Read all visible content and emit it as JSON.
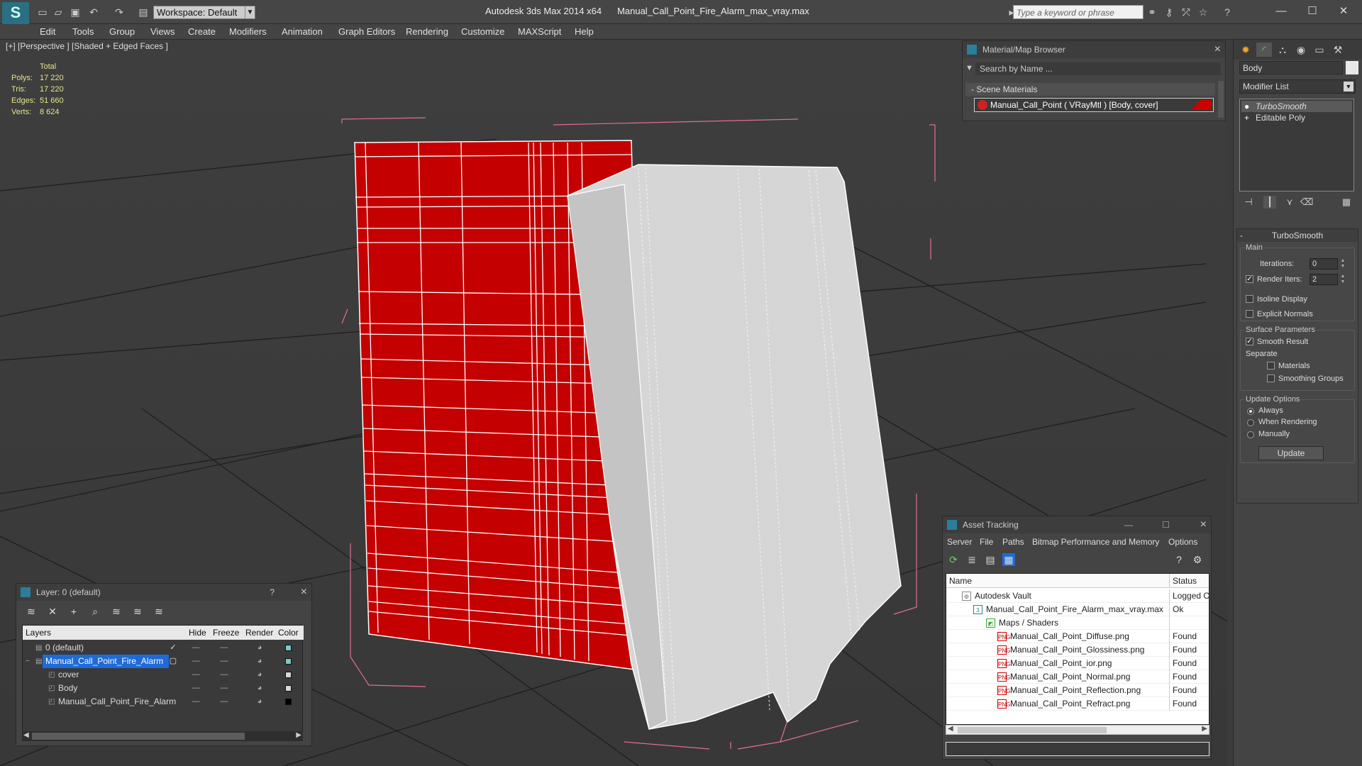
{
  "app": {
    "title": "Autodesk 3ds Max  2014 x64",
    "file": "Manual_Call_Point_Fire_Alarm_max_vray.max",
    "workspace": "Workspace: Default",
    "search_placeholder": "Type a keyword or phrase"
  },
  "menu": [
    "Edit",
    "Tools",
    "Group",
    "Views",
    "Create",
    "Modifiers",
    "Animation",
    "Graph Editors",
    "Rendering",
    "Customize",
    "MAXScript",
    "Help"
  ],
  "viewport": {
    "label": "[+] [Perspective ] [Shaded + Edged Faces ]",
    "stats": {
      "header": "Total",
      "rows": [
        {
          "k": "Polys:",
          "v": "17 220"
        },
        {
          "k": "Tris:",
          "v": "17 220"
        },
        {
          "k": "Edges:",
          "v": "51 660"
        },
        {
          "k": "Verts:",
          "v": "8 624"
        }
      ]
    },
    "colors": {
      "body": "#c40000",
      "cover": "#d9d9d9",
      "wire": "#ffffff",
      "bbox": "#e06a9a",
      "grid": "#1a1a1a"
    }
  },
  "material_browser": {
    "title": "Material/Map Browser",
    "search": "Search by Name ...",
    "section": "- Scene Materials",
    "material": "Manual_Call_Point  ( VRayMtl )  [Body, cover]"
  },
  "command_panel": {
    "object_name": "Body",
    "modifier_list": "Modifier List",
    "stack": [
      "TurboSmooth",
      "Editable Poly"
    ],
    "turbosmooth": {
      "title": "TurboSmooth",
      "main": "Main",
      "iterations_label": "Iterations:",
      "iterations": "0",
      "render_iters_label": "Render Iters:",
      "render_iters": "2",
      "isoline": "Isoline Display",
      "explicit": "Explicit Normals",
      "surface": "Surface Parameters",
      "smooth_result": "Smooth Result",
      "separate": "Separate",
      "materials": "Materials",
      "smoothing_groups": "Smoothing Groups",
      "update_options": "Update Options",
      "always": "Always",
      "when_rendering": "When Rendering",
      "manually": "Manually",
      "update_button": "Update"
    }
  },
  "layer_panel": {
    "title": "Layer: 0 (default)",
    "help": "?",
    "columns": {
      "layers": "Layers",
      "hide": "Hide",
      "freeze": "Freeze",
      "render": "Render",
      "color": "Color"
    },
    "rows": [
      {
        "name": "0 (default)",
        "indent": 1,
        "color": "#7ec8c8"
      },
      {
        "name": "Manual_Call_Point_Fire_Alarm",
        "indent": 1,
        "color": "#7ec8c8",
        "selected": true
      },
      {
        "name": "cover",
        "indent": 2,
        "color": "#d8d8d8"
      },
      {
        "name": "Body",
        "indent": 2,
        "color": "#d8d8d8"
      },
      {
        "name": "Manual_Call_Point_Fire_Alarm",
        "indent": 2,
        "color": "#000000"
      }
    ]
  },
  "asset_tracking": {
    "title": "Asset Tracking",
    "menu": [
      "Server",
      "File",
      "Paths",
      "Bitmap Performance and Memory",
      "Options"
    ],
    "columns": {
      "name": "Name",
      "status": "Status"
    },
    "rows": [
      {
        "name": "Autodesk Vault",
        "status": "Logged Out",
        "indent": 1,
        "icon": "vault-icon"
      },
      {
        "name": "Manual_Call_Point_Fire_Alarm_max_vray.max",
        "status": "Ok",
        "indent": 2,
        "icon": "max-file-icon"
      },
      {
        "name": "Maps / Shaders",
        "status": "",
        "indent": 3,
        "icon": "maps-icon"
      },
      {
        "name": "Manual_Call_Point_Diffuse.png",
        "status": "Found",
        "indent": 4,
        "icon": "png-icon"
      },
      {
        "name": "Manual_Call_Point_Glossiness.png",
        "status": "Found",
        "indent": 4,
        "icon": "png-icon"
      },
      {
        "name": "Manual_Call_Point_ior.png",
        "status": "Found",
        "indent": 4,
        "icon": "png-icon"
      },
      {
        "name": "Manual_Call_Point_Normal.png",
        "status": "Found",
        "indent": 4,
        "icon": "png-icon"
      },
      {
        "name": "Manual_Call_Point_Reflection.png",
        "status": "Found",
        "indent": 4,
        "icon": "png-icon"
      },
      {
        "name": "Manual_Call_Point_Refract.png",
        "status": "Found",
        "indent": 4,
        "icon": "png-icon"
      }
    ]
  }
}
